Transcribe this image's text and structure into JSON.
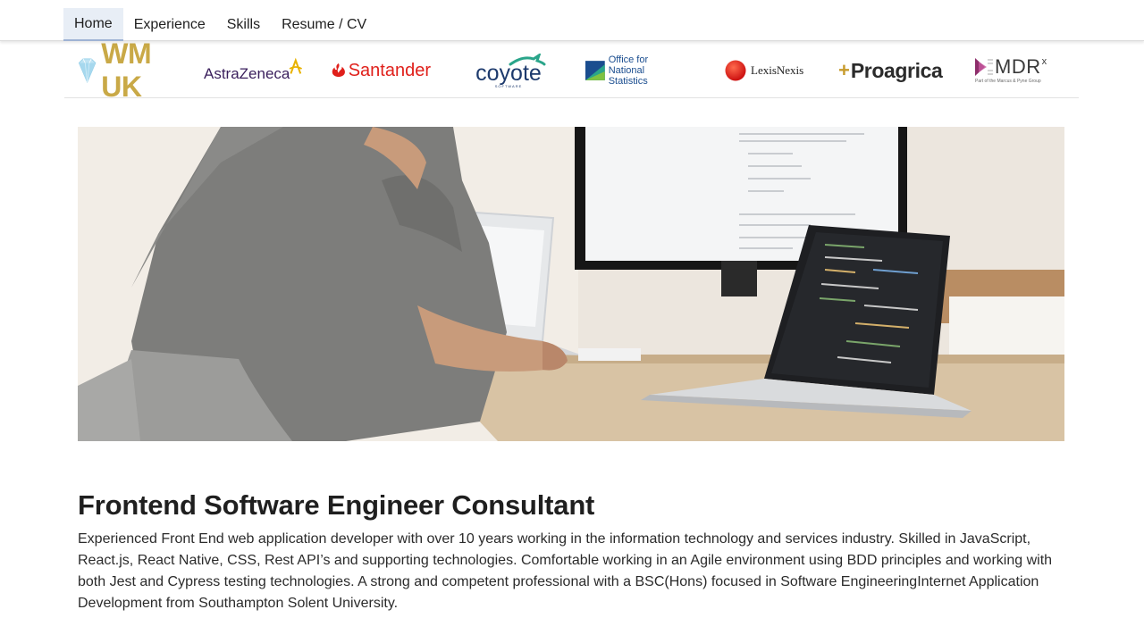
{
  "nav": {
    "items": [
      {
        "label": "Home",
        "active": true
      },
      {
        "label": "Experience",
        "active": false
      },
      {
        "label": "Skills",
        "active": false
      },
      {
        "label": "Resume / CV",
        "active": false
      }
    ]
  },
  "logos": {
    "wm": "WM UK",
    "astrazeneca": "AstraZeneca",
    "santander": "Santander",
    "coyote": "coyote",
    "coyote_sub": "SOFTWARE",
    "ons_line1": "Office for",
    "ons_line2": "National Statistics",
    "lexisnexis": "LexisNexis",
    "proagrica": "Proagrica",
    "mdr": "MDR",
    "mdr_sup": "x",
    "mdr_sub": "Part of the Marcus & Pyne Group"
  },
  "hero": {
    "icon": "photo-person-at-desk-with-laptops"
  },
  "content": {
    "title": "Frontend Software Engineer Consultant",
    "description": "Experienced Front End web application developer with over 10 years working in the information technology and services industry. Skilled in JavaScript, React.js, React Native, CSS, Rest API’s and supporting technologies. Comfortable working in an Agile environment using BDD principles and working with both Jest and Cypress testing technologies. A strong and competent professional with a BSC(Hons) focused in Software EngineeringInternet Application Development from Southampton Solent University."
  },
  "colors": {
    "nav_active_bg": "#e8eef6",
    "santander_red": "#e0201b",
    "wm_gold": "#c9a947"
  }
}
